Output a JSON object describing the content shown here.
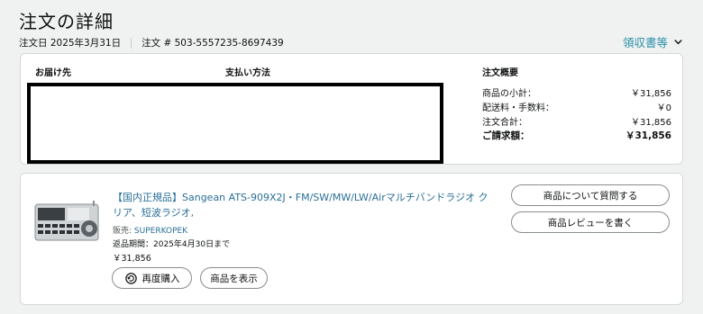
{
  "page": {
    "title": "注文の詳細"
  },
  "meta": {
    "order_date": "注文日 2025年3月31日",
    "order_number": "注文 # 503-5557235-8697439",
    "invoice_label": "領収書等"
  },
  "summary": {
    "ship_to_label": "お届け先",
    "payment_label": "支払い方法",
    "overview_label": "注文概要",
    "rows": [
      {
        "label": "商品の小計：",
        "value": "￥31,856"
      },
      {
        "label": "配送料・手数料：",
        "value": "￥0"
      },
      {
        "label": "注文合計：",
        "value": "￥31,856"
      }
    ],
    "total": {
      "label": "ご請求額：",
      "value": "￥31,856"
    }
  },
  "item": {
    "title": "【国内正規品】Sangean ATS-909X2J・FM/SW/MW/LW/Airマルチバンドラジオ クリア、短波ラジオ,",
    "seller_label": "販売:",
    "seller_name": "SUPERKOPEK",
    "return_deadline": "返品期間：2025年4月30日まで",
    "price": "￥31,856",
    "buy_again_label": "再度購入",
    "view_item_label": "商品を表示",
    "ask_question_label": "商品について質問する",
    "write_review_label": "商品レビューを書く"
  },
  "colors": {
    "link": "#2a6f97",
    "accent_link": "#2a8fa6"
  },
  "icons": [
    "chevron-down-icon",
    "buy-again-icon",
    "product-image"
  ]
}
